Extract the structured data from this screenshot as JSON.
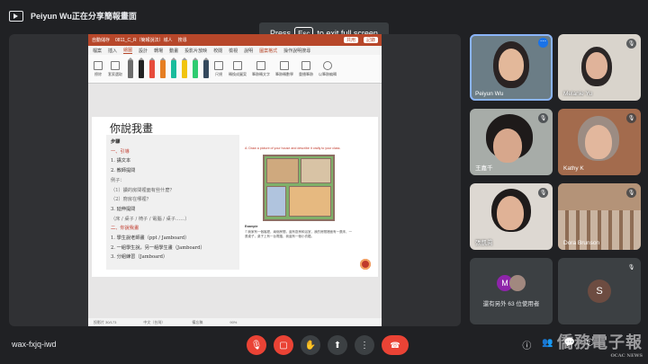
{
  "presenting": {
    "text": "Peiyun Wu正在分享簡報畫面"
  },
  "fullscreen": {
    "press": "Press",
    "key": "Esc",
    "suffix": "to exit full screen"
  },
  "ppt": {
    "autosave": "自動儲存",
    "filename": "0811_C_R（簡報說法）城人",
    "search": "搜尋",
    "share": "共用",
    "record": "記錄",
    "tabs": [
      "檔案",
      "插入",
      "繪圖",
      "設計",
      "轉場",
      "動畫",
      "投影片放映",
      "校閱",
      "檢視",
      "說明",
      "圖案格式",
      "操作說明搜尋"
    ],
    "active_tab": "繪圖",
    "ribbon": {
      "eraser": "擦除",
      "lasso": "套索選取",
      "ruler": "尺規",
      "ink_to_shape": "轉換成圖案",
      "ink_to_text": "筆跡轉文字",
      "ink_to_math": "筆跡轉數學",
      "replay": "重播筆跡",
      "ink_replay": "以筆跡編輯"
    },
    "pen_colors": [
      "#6d6d6d",
      "#222222",
      "#e74c3c",
      "#e67e22",
      "#1abc9c",
      "#f1c40f",
      "#2ecc71",
      "#34495e"
    ],
    "status_left": "投影片 30/173",
    "status_lang": "中文（台灣）",
    "status_notes": "備忘稿",
    "status_zoom": "90%"
  },
  "slide": {
    "title": "你說我畫",
    "steps_label": "步驟",
    "section1": "一、引導",
    "s1": "1.  講文本",
    "s2": "2.  教師提問",
    "example_label": "例子：",
    "q1": "（1）讀的房間裡面有些什麼？",
    "q2": "（2）廚房在哪裡？",
    "s3": "3.  延伸提問",
    "s3b": "（床 / 桌子 / 椅子 / 電腦 / 桌子……）",
    "section2": "二、你說我畫",
    "p1": "1.  學生說老師畫（ppt / Jamboard）",
    "p2": "2.  一組學生說，另一組學生畫（Jamboard）",
    "p3": "3.  分組練習（Jamboard）",
    "ex_caption": "A. Draw a picture of your house and describe it orally to your class.",
    "example_title": "Example",
    "example_body": "①我家有一個客廳，兩個房間，還有廚房和浴室，我的房間裡面有一張床，一張桌子，桌子上有一台電腦，我還有一個小衣櫃。"
  },
  "participants": [
    {
      "name": "Peiyun Wu",
      "speaking": true,
      "more": true
    },
    {
      "name": "Melanie Yu",
      "muted": true
    },
    {
      "name": "王嘉千",
      "muted": true
    },
    {
      "name": "Kathy K",
      "muted": true
    },
    {
      "name": "張凱眞",
      "muted": true
    },
    {
      "name": "Dora Brunson",
      "muted": true
    }
  ],
  "others": {
    "text": "還有另外 63 位使用者",
    "avatar_m": "M",
    "avatar_s": "S"
  },
  "meeting": {
    "code": "wax-fxjq-iwd"
  },
  "watermark": {
    "main": "僑務電子報",
    "sub": "OCAC NEWS"
  }
}
